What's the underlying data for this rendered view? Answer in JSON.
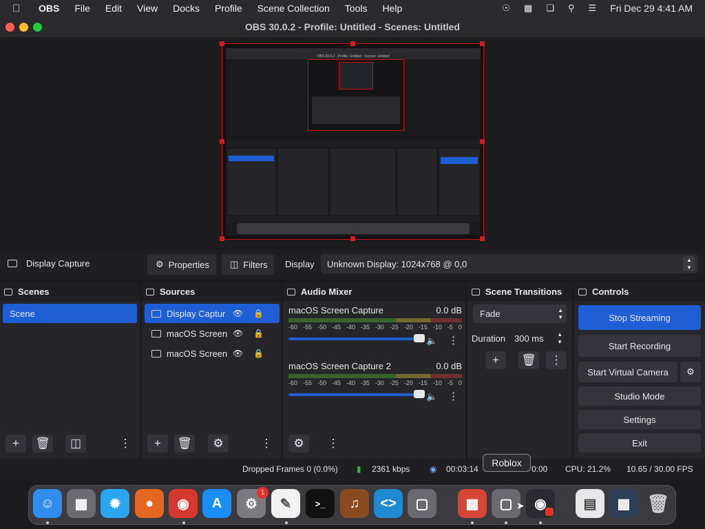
{
  "menubar": {
    "apple": "",
    "app_name": "OBS",
    "items": [
      "File",
      "Edit",
      "View",
      "Docks",
      "Profile",
      "Scene Collection",
      "Tools",
      "Help"
    ],
    "datetime": "Fri Dec 29  4:41 AM"
  },
  "window": {
    "title": "OBS 30.0.2 - Profile: Untitled - Scenes: Untitled",
    "traffic_colors": [
      "#ff5f57",
      "#febc2e",
      "#28c840"
    ]
  },
  "preview": {
    "nested_title": "OBS 30.0.2 - Profile: Untitled - Scenes: Untitled",
    "tooltip_small": "Roblox"
  },
  "sourcebar": {
    "source_name": "Display Capture",
    "properties_label": "Properties",
    "filters_label": "Filters",
    "display_label": "Display",
    "display_value": "Unknown Display: 1024x768 @ 0,0"
  },
  "scenes": {
    "title": "Scenes",
    "items": [
      "Scene"
    ]
  },
  "sources": {
    "title": "Sources",
    "items": [
      "Display Captur",
      "macOS Screen",
      "macOS Screen"
    ]
  },
  "audio_mixer": {
    "title": "Audio Mixer",
    "channels": [
      {
        "name": "macOS Screen Capture",
        "db": "0.0 dB",
        "volume": 1.0
      },
      {
        "name": "macOS Screen Capture 2",
        "db": "0.0 dB",
        "volume": 1.0
      }
    ],
    "ticks": [
      "-60",
      "-55",
      "-50",
      "-45",
      "-40",
      "-35",
      "-30",
      "-25",
      "-20",
      "-15",
      "-10",
      "-5",
      "0"
    ]
  },
  "transitions": {
    "title": "Scene Transitions",
    "selected": "Fade",
    "duration_label": "Duration",
    "duration_value": "300 ms"
  },
  "controls": {
    "title": "Controls",
    "stop_streaming": "Stop Streaming",
    "start_recording": "Start Recording",
    "start_virtual_camera": "Start Virtual Camera",
    "studio_mode": "Studio Mode",
    "settings": "Settings",
    "exit": "Exit",
    "accent": "#1f5fd6"
  },
  "status": {
    "dropped_frames": "Dropped Frames 0 (0.0%)",
    "bitrate": "2361 kbps",
    "stream_time": "00:03:14",
    "rec_time": "0:00",
    "cpu": "CPU: 21.2%",
    "fps": "10.65 / 30.00 FPS"
  },
  "dock": {
    "tooltip": "Roblox",
    "badge": "1",
    "apps": [
      "finder-icon",
      "launchpad-icon",
      "safari-icon",
      "firefox-icon",
      "chrome-icon",
      "app-store-icon",
      "system-settings-icon",
      "textedit-icon",
      "terminal-icon",
      "garageband-icon",
      "vscode-icon",
      "roblox-icon",
      "remote-desktop-icon",
      "roblox-studio-icon",
      "obs-icon",
      "preview-icon",
      "screenshot-icon",
      "trash-icon"
    ]
  }
}
